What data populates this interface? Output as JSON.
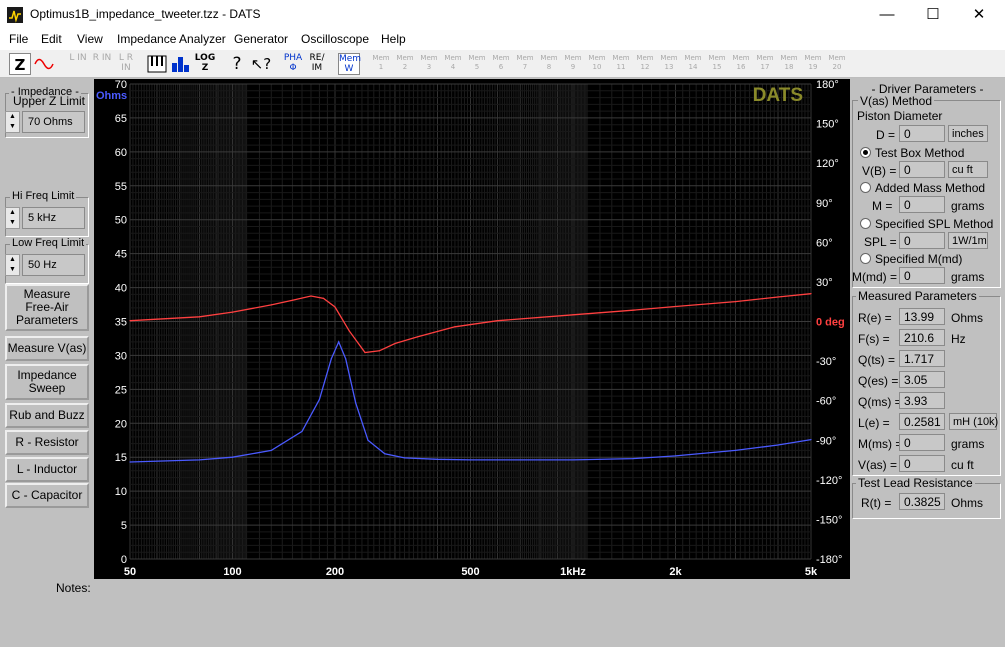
{
  "window": {
    "title": "Optimus1B_impedance_tweeter.tzz - DATS",
    "minimize": "—",
    "maximize": "☐",
    "close": "✕"
  },
  "menu": [
    "File",
    "Edit",
    "View",
    "Impedance Analyzer",
    "Generator",
    "Oscilloscope",
    "Help"
  ],
  "toolbar": {
    "left": [
      "L IN",
      "R IN",
      "L R IN"
    ],
    "pha": "PHA Φ",
    "reim": "RE/ IM",
    "memw": "Mem W",
    "log": "LOG Z",
    "mem": [
      "Mem 1",
      "Mem 2",
      "Mem 3",
      "Mem 4",
      "Mem 5",
      "Mem 6",
      "Mem 7",
      "Mem 8",
      "Mem 9",
      "Mem 10",
      "Mem 11",
      "Mem 12",
      "Mem 13",
      "Mem 14",
      "Mem 15",
      "Mem 16",
      "Mem 17",
      "Mem 18",
      "Mem 19",
      "Mem 20"
    ]
  },
  "left": {
    "impedance_group": "- Impedance -",
    "upper_z_label": "Upper Z Limit",
    "upper_z": "70 Ohms",
    "hi_freq_label": "Hi Freq Limit",
    "hi_freq": "5 kHz",
    "low_freq_label": "Low Freq Limit",
    "low_freq": "50 Hz",
    "buttons": [
      "Measure Free-Air Parameters",
      "Measure V(as)",
      "Impedance Sweep",
      "Rub and Buzz",
      "R - Resistor",
      "L - Inductor",
      "C - Capacitor"
    ]
  },
  "notes_label": "Notes:",
  "chart_data": {
    "type": "line",
    "watermark": "DATS",
    "x_scale": "log",
    "xlim": [
      50,
      5000
    ],
    "x_ticks": [
      50,
      100,
      200,
      500,
      1000,
      2000,
      5000
    ],
    "x_tick_labels": [
      "50",
      "100",
      "200",
      "500",
      "1kHz",
      "2k",
      "5k"
    ],
    "ylim": [
      0,
      70
    ],
    "y_ticks": [
      0,
      5,
      10,
      15,
      20,
      25,
      30,
      35,
      40,
      45,
      50,
      55,
      60,
      65,
      70
    ],
    "y_tick_labels": [
      "0",
      "5",
      "10",
      "15",
      "20",
      "25",
      "30",
      "35",
      "40",
      "45",
      "50",
      "55",
      "60",
      "65",
      "70"
    ],
    "ylabel": "Ohms",
    "y2lim": [
      -180,
      180
    ],
    "y2_ticks": [
      180,
      150,
      120,
      90,
      60,
      30,
      0,
      -30,
      -60,
      -90,
      -120,
      -150,
      -180
    ],
    "y2_tick_labels": [
      "180°",
      "150°",
      "120°",
      "90°",
      "60°",
      "30°",
      "0 deg",
      "-30°",
      "-60°",
      "-90°",
      "-120°",
      "-150°",
      "-180°"
    ],
    "grid": true,
    "series": [
      {
        "axis": "left",
        "color": "#4a5aff",
        "x": [
          50,
          80,
          100,
          130,
          160,
          180,
          195,
          205,
          215,
          230,
          250,
          280,
          320,
          400,
          500,
          700,
          1000,
          1500,
          2000,
          3000,
          4000,
          5000
        ],
        "y": [
          14.3,
          14.6,
          15.0,
          16.0,
          18.8,
          23.5,
          29.5,
          32.0,
          29.5,
          23.0,
          17.5,
          15.5,
          14.9,
          14.7,
          14.6,
          14.6,
          14.6,
          14.8,
          15.2,
          16.0,
          16.8,
          17.6
        ]
      },
      {
        "axis": "right",
        "color": "#ff4040",
        "x": [
          50,
          80,
          100,
          130,
          150,
          170,
          185,
          200,
          220,
          245,
          270,
          300,
          350,
          450,
          600,
          1000,
          1500,
          2000,
          3000,
          4000,
          5000
        ],
        "y": [
          0.6,
          3.6,
          7.1,
          12.6,
          16.1,
          19.3,
          17.5,
          11.0,
          -7.0,
          -23.5,
          -22.2,
          -16.7,
          -11.5,
          -4.0,
          0.6,
          5.1,
          8.6,
          11.4,
          15.1,
          18.6,
          21.1
        ]
      }
    ]
  },
  "right": {
    "title": "- Driver Parameters -",
    "vas_method": "V(as) Method",
    "piston_diameter": "Piston Diameter",
    "d_label": "D =",
    "d_val": "0",
    "d_unit": "inches",
    "test_box": "Test Box Method",
    "vb_label": "V(B) =",
    "vb_val": "0",
    "vb_unit": "cu ft",
    "added_mass": "Added Mass Method",
    "m_label": "M =",
    "m_val": "0",
    "m_unit": "grams",
    "spec_spl": "Specified SPL Method",
    "spl_label": "SPL =",
    "spl_val": "0",
    "spl_unit": "1W/1m",
    "spec_mmd": "Specified M(md)",
    "mmd_label": "M(md) =",
    "mmd_val": "0",
    "mmd_unit": "grams",
    "measured": "Measured Parameters",
    "params": [
      {
        "label": "R(e) =",
        "value": "13.99",
        "unit": "Ohms"
      },
      {
        "label": "F(s) =",
        "value": "210.6",
        "unit": "Hz"
      },
      {
        "label": "Q(ts) =",
        "value": "1.717",
        "unit": ""
      },
      {
        "label": "Q(es) =",
        "value": "3.05",
        "unit": ""
      },
      {
        "label": "Q(ms) =",
        "value": "3.93",
        "unit": ""
      },
      {
        "label": "L(e) =",
        "value": "0.2581",
        "unit": "mH (10k)"
      },
      {
        "label": "M(ms) =",
        "value": "0",
        "unit": "grams"
      },
      {
        "label": "V(as) =",
        "value": "0",
        "unit": "cu ft"
      }
    ],
    "test_lead": "Test Lead Resistance",
    "rt_label": "R(t) =",
    "rt_val": "0.3825",
    "rt_unit": "Ohms"
  }
}
